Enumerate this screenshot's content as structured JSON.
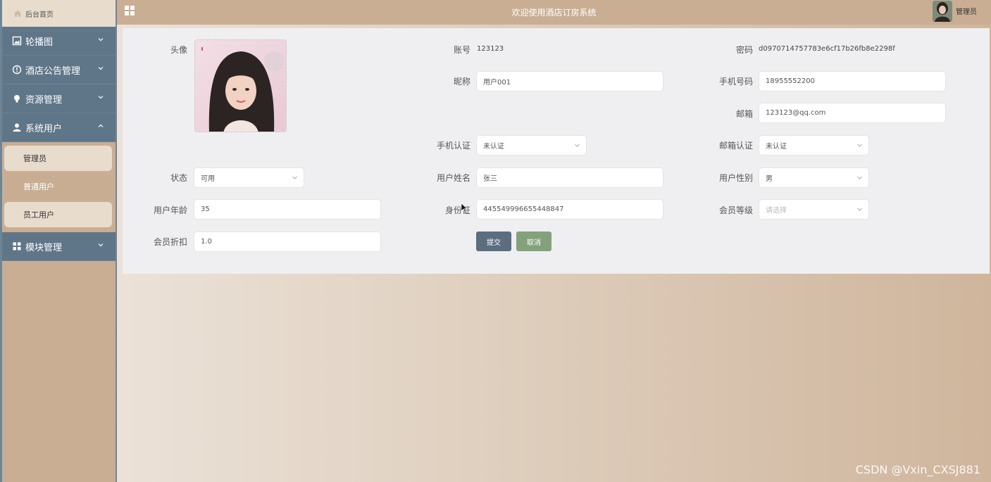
{
  "sidebar": {
    "home_label": "后台首页",
    "menus": [
      {
        "label": "轮播图",
        "icon": "image-icon"
      },
      {
        "label": "酒店公告管理",
        "icon": "info-icon"
      },
      {
        "label": "资源管理",
        "icon": "bulb-icon"
      },
      {
        "label": "系统用户",
        "icon": "user-icon"
      },
      {
        "label": "模块管理",
        "icon": "grid-icon"
      }
    ],
    "sub_items": [
      "管理员",
      "普通用户",
      "员工用户"
    ]
  },
  "header": {
    "title": "欢迎使用酒店订房系统",
    "user": "管理员"
  },
  "form": {
    "avatar_label": "头像",
    "account_label": "账号",
    "account_value": "123123",
    "password_label": "密码",
    "password_value": "d0970714757783e6cf17b26fb8e2298f",
    "nickname_label": "昵称",
    "nickname_value": "用户001",
    "phone_label": "手机号码",
    "phone_value": "18955552200",
    "email_label": "邮箱",
    "email_value": "123123@qq.com",
    "phone_verify_label": "手机认证",
    "phone_verify_value": "未认证",
    "email_verify_label": "邮箱认证",
    "email_verify_value": "未认证",
    "status_label": "状态",
    "status_value": "可用",
    "realname_label": "用户姓名",
    "realname_value": "张三",
    "gender_label": "用户性别",
    "gender_value": "男",
    "age_label": "用户年龄",
    "age_value": "35",
    "idcard_label": "身份证",
    "idcard_value": "445549996655448847",
    "level_label": "会员等级",
    "level_placeholder": "请选择",
    "discount_label": "会员折扣",
    "discount_value": "1.0",
    "submit_label": "提交",
    "cancel_label": "取消"
  },
  "watermark": "CSDN @Vxin_CXSJ881",
  "colors": {
    "sidebar_menu": "#5f7689",
    "accent_tan": "#c9ae93",
    "submit": "#5b6e80",
    "cancel": "#83a27c"
  }
}
